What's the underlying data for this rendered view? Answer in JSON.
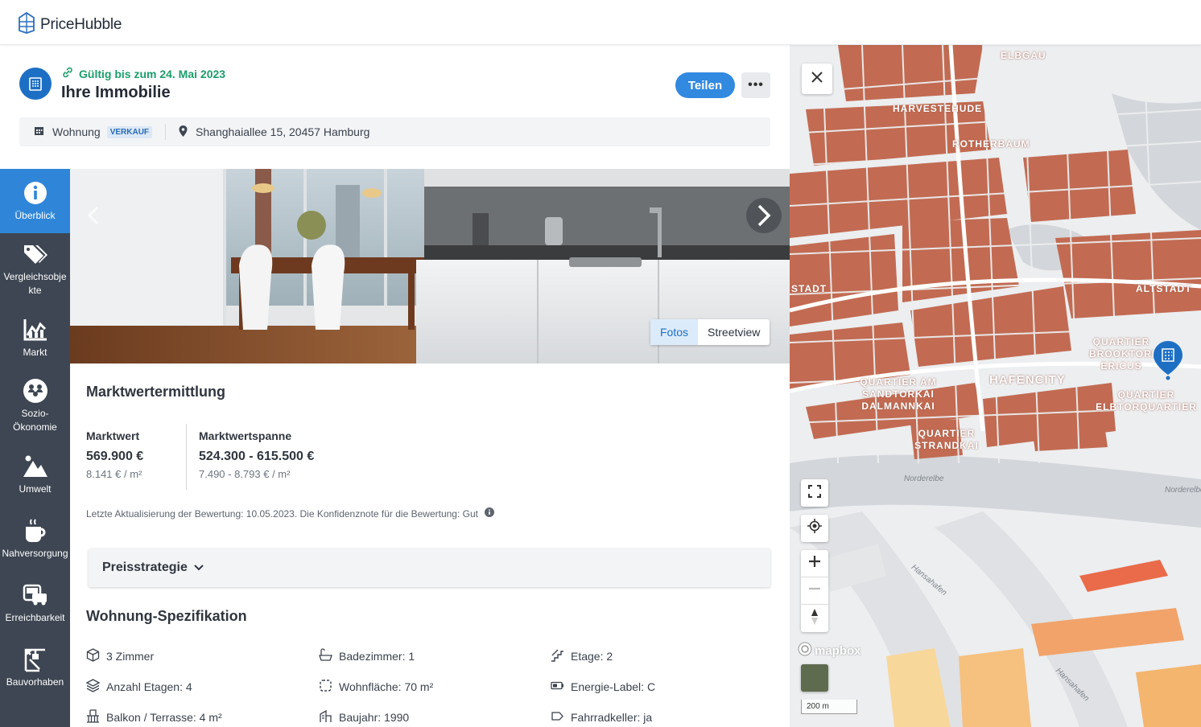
{
  "app": {
    "logo_text": "PriceHubble"
  },
  "header": {
    "valid_text": "Gültig bis zum 24. Mai 2023",
    "title": "Ihre Immobilie",
    "share_label": "Teilen",
    "more_label": "•••",
    "property_type": "Wohnung",
    "property_tag": "VERKAUF",
    "address": "Shanghaiallee 15, 20457 Hamburg"
  },
  "sidebar": {
    "items": [
      {
        "label": "Überblick",
        "icon": "info-icon",
        "active": true
      },
      {
        "label": "Vergleichsobje kte",
        "icon": "tags-icon"
      },
      {
        "label": "Markt",
        "icon": "market-chart-icon"
      },
      {
        "label": "Sozio-Ökonomie",
        "icon": "people-icon"
      },
      {
        "label": "Umwelt",
        "icon": "mountain-icon"
      },
      {
        "label": "Nahversorgung",
        "icon": "coffee-cup-icon"
      },
      {
        "label": "Erreichbarkeit",
        "icon": "transport-icon"
      },
      {
        "label": "Bauvorhaben",
        "icon": "crane-icon"
      }
    ]
  },
  "photo": {
    "toggle_photos": "Fotos",
    "toggle_streetview": "Streetview"
  },
  "valuation": {
    "heading": "Marktwertermittlung",
    "market_value_label": "Marktwert",
    "market_value": "569.900 €",
    "market_value_sqm": "8.141 € / m²",
    "range_label": "Marktwertspanne",
    "range_value": "524.300 - 615.500 €",
    "range_sqm": "7.490 - 8.793 € / m²",
    "note": "Letzte Aktualisierung der Bewertung: 10.05.2023. Die Konfidenznote für die Bewertung: Gut"
  },
  "strategy": {
    "label": "Preisstrategie"
  },
  "spec": {
    "heading": "Wohnung-Spezifikation",
    "rooms": "3 Zimmer",
    "bathrooms": "Badezimmer: 1",
    "floor": "Etage: 2",
    "floors_count": "Anzahl Etagen: 4",
    "living_area": "Wohnfläche: 70 m²",
    "energy_label": "Energie-Label: C",
    "balcony": "Balkon / Terrasse: 4 m²",
    "year_built": "Baujahr: 1990",
    "bike_cellar": "Fahrradkeller: ja"
  },
  "map": {
    "labels": [
      "ELBGAU",
      "HARVESTEHUDE",
      "ROTHERBAUM",
      "STADT",
      "ALTSTADT",
      "QUARTIER BROOKTORKAI ERICUS",
      "QUARTIER AM SANDTORKAI DALMANNKAI",
      "HAFENCITY",
      "QUARTIER ELBTORQUARTIER",
      "QUARTIER STRANDKAI"
    ],
    "water_labels": [
      "Norderelbe",
      "Norderelbe",
      "Hansahafen",
      "Hansahafen"
    ],
    "scale": "200 m",
    "attribution": "mapbox",
    "colors": {
      "buildings": "#c26b52",
      "water": "#d3d6da",
      "land": "#eceef0"
    }
  }
}
